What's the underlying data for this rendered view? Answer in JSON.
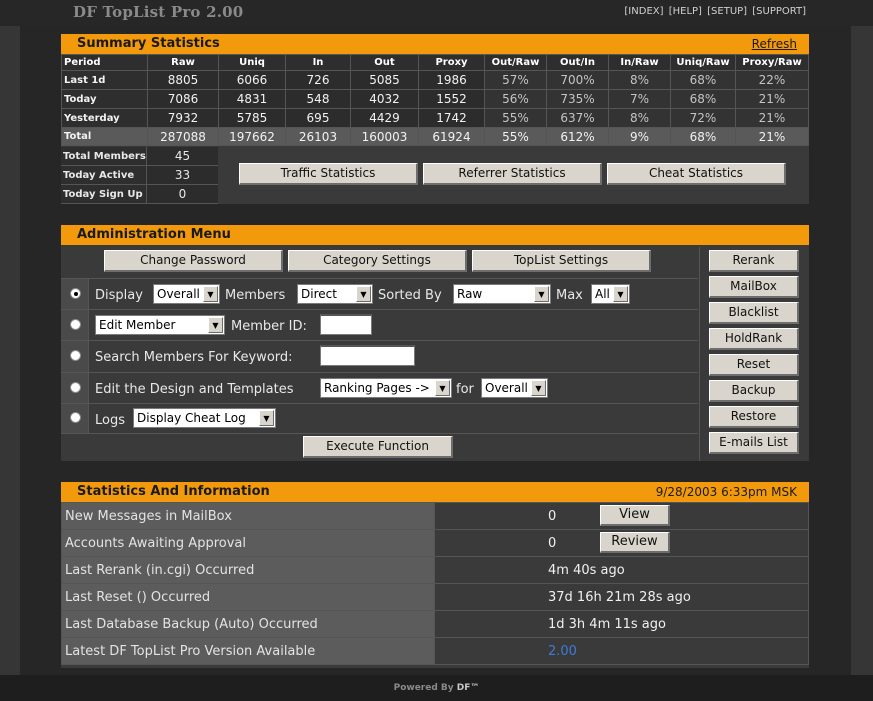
{
  "app": {
    "title": "DF TopList Pro 2.00",
    "nav": [
      "[INDEX]",
      "[HELP]",
      "[SETUP]",
      "[SUPPORT]"
    ],
    "footer_prefix": "Powered By",
    "footer_brand": "DF™"
  },
  "summary": {
    "title": "Summary Statistics",
    "refresh": "Refresh",
    "columns": [
      "Period",
      "Raw",
      "Uniq",
      "In",
      "Out",
      "Proxy",
      "Out/Raw",
      "Out/In",
      "In/Raw",
      "Uniq/Raw",
      "Proxy/Raw"
    ],
    "rows": [
      {
        "period": "Last 1d",
        "raw": "8805",
        "uniq": "6066",
        "in": "726",
        "out": "5085",
        "proxy": "1986",
        "out_raw": "57%",
        "out_in": "700%",
        "in_raw": "8%",
        "uniq_raw": "68%",
        "proxy_raw": "22%"
      },
      {
        "period": "Today",
        "raw": "7086",
        "uniq": "4831",
        "in": "548",
        "out": "4032",
        "proxy": "1552",
        "out_raw": "56%",
        "out_in": "735%",
        "in_raw": "7%",
        "uniq_raw": "68%",
        "proxy_raw": "21%"
      },
      {
        "period": "Yesterday",
        "raw": "7932",
        "uniq": "5785",
        "in": "695",
        "out": "4429",
        "proxy": "1742",
        "out_raw": "55%",
        "out_in": "637%",
        "in_raw": "8%",
        "uniq_raw": "72%",
        "proxy_raw": "21%"
      },
      {
        "period": "Total",
        "raw": "287088",
        "uniq": "197662",
        "in": "26103",
        "out": "160003",
        "proxy": "61924",
        "out_raw": "55%",
        "out_in": "612%",
        "in_raw": "9%",
        "uniq_raw": "68%",
        "proxy_raw": "21%"
      }
    ],
    "members": [
      {
        "label": "Total Members",
        "value": "45"
      },
      {
        "label": "Today Active",
        "value": "33"
      },
      {
        "label": "Today Sign Up",
        "value": "0"
      }
    ],
    "buttons": [
      "Traffic Statistics",
      "Referrer Statistics",
      "Cheat Statistics"
    ]
  },
  "admin": {
    "title": "Administration Menu",
    "top_buttons": [
      "Change Password",
      "Category Settings",
      "TopList Settings"
    ],
    "row1": {
      "display": "Display",
      "overall": "Overall",
      "members": "Members",
      "direct": "Direct",
      "sorted_by": "Sorted By",
      "raw": "Raw",
      "max": "Max",
      "all": "All"
    },
    "row2": {
      "select": "Edit Member",
      "member_id": "Member ID:"
    },
    "row3": {
      "label": "Search Members For Keyword:"
    },
    "row4": {
      "label": "Edit the Design and Templates",
      "select": "Ranking Pages ->",
      "for": "for",
      "overall": "Overall"
    },
    "row5": {
      "label": "Logs",
      "select": "Display Cheat Log"
    },
    "execute": "Execute Function",
    "side_buttons": [
      "Rerank",
      "MailBox",
      "Blacklist",
      "HoldRank",
      "Reset",
      "Backup",
      "Restore",
      "E-mails List"
    ]
  },
  "info": {
    "title": "Statistics And Information",
    "datetime": "9/28/2003 6:33pm MSK",
    "rows": [
      {
        "label": "New Messages in MailBox",
        "value": "0",
        "button": "View"
      },
      {
        "label": "Accounts Awaiting Approval",
        "value": "0",
        "button": "Review"
      },
      {
        "label": "Last Rerank (in.cgi) Occurred",
        "value": "4m 40s ago"
      },
      {
        "label": "Last Reset () Occurred",
        "value": "37d 16h 21m 28s ago"
      },
      {
        "label": "Last Database Backup (Auto) Occurred",
        "value": "1d 3h 4m 11s ago"
      },
      {
        "label": "Latest DF TopList Pro Version Available",
        "value": "2.00"
      }
    ]
  },
  "colors": {
    "accent": "#f39a0c",
    "background": "#242424",
    "panel": "#3a3a3a",
    "version_link": "#3d7bd8"
  }
}
